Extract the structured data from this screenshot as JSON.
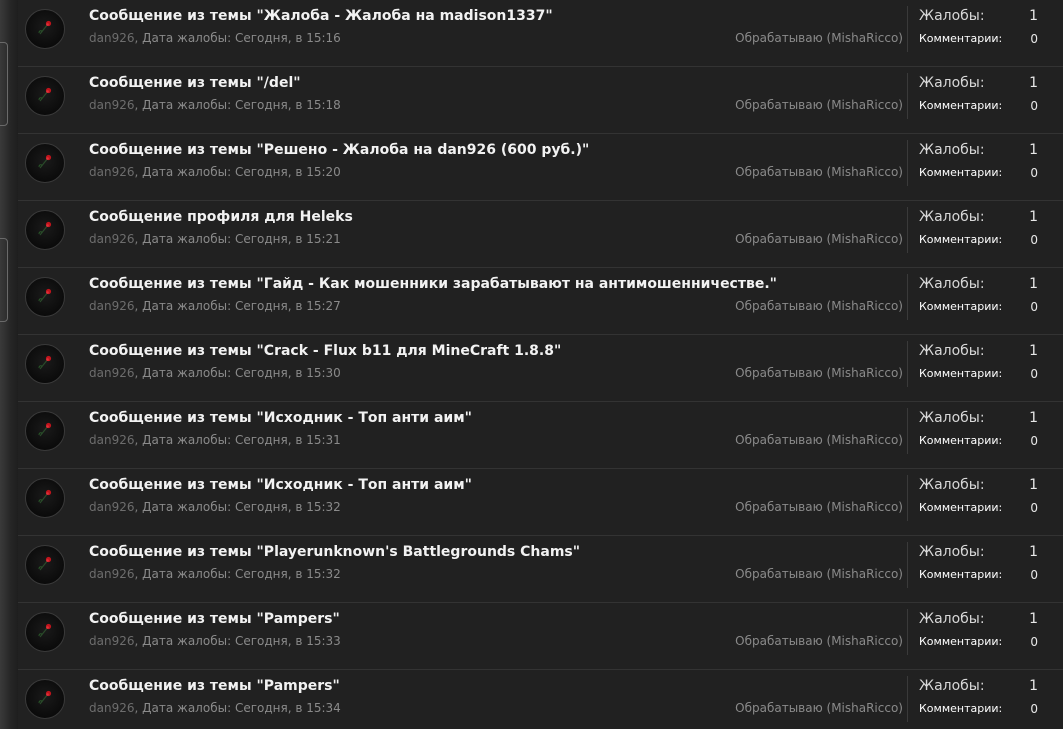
{
  "reports": [
    {
      "title": "Сообщение из темы \"Жалоба - Жалоба на madison1337\"",
      "user": "dan926",
      "date_label": "Дата жалобы:",
      "date": "Сегодня, в 15:16",
      "status": "Обрабатываю (MishaRicco)",
      "complaints_label": "Жалобы:",
      "complaints": "1",
      "comments_label": "Комментарии:",
      "comments": "0"
    },
    {
      "title": "Сообщение из темы \"/del\"",
      "user": "dan926",
      "date_label": "Дата жалобы:",
      "date": "Сегодня, в 15:18",
      "status": "Обрабатываю (MishaRicco)",
      "complaints_label": "Жалобы:",
      "complaints": "1",
      "comments_label": "Комментарии:",
      "comments": "0"
    },
    {
      "title": "Сообщение из темы \"Решено - Жалоба на dan926 (600 руб.)\"",
      "user": "dan926",
      "date_label": "Дата жалобы:",
      "date": "Сегодня, в 15:20",
      "status": "Обрабатываю (MishaRicco)",
      "complaints_label": "Жалобы:",
      "complaints": "1",
      "comments_label": "Комментарии:",
      "comments": "0"
    },
    {
      "title": "Сообщение профиля для Heleks",
      "user": "dan926",
      "date_label": "Дата жалобы:",
      "date": "Сегодня, в 15:21",
      "status": "Обрабатываю (MishaRicco)",
      "complaints_label": "Жалобы:",
      "complaints": "1",
      "comments_label": "Комментарии:",
      "comments": "0"
    },
    {
      "title": "Сообщение из темы \"Гайд - Как мошенники зарабатывают на антимошенничестве.\"",
      "user": "dan926",
      "date_label": "Дата жалобы:",
      "date": "Сегодня, в 15:27",
      "status": "Обрабатываю (MishaRicco)",
      "complaints_label": "Жалобы:",
      "complaints": "1",
      "comments_label": "Комментарии:",
      "comments": "0"
    },
    {
      "title": "Сообщение из темы \"Crack - Flux b11 для MineCraft 1.8.8\"",
      "user": "dan926",
      "date_label": "Дата жалобы:",
      "date": "Сегодня, в 15:30",
      "status": "Обрабатываю (MishaRicco)",
      "complaints_label": "Жалобы:",
      "complaints": "1",
      "comments_label": "Комментарии:",
      "comments": "0"
    },
    {
      "title": "Сообщение из темы \"Исходник - Топ анти аим\"",
      "user": "dan926",
      "date_label": "Дата жалобы:",
      "date": "Сегодня, в 15:31",
      "status": "Обрабатываю (MishaRicco)",
      "complaints_label": "Жалобы:",
      "complaints": "1",
      "comments_label": "Комментарии:",
      "comments": "0"
    },
    {
      "title": "Сообщение из темы \"Исходник - Топ анти аим\"",
      "user": "dan926",
      "date_label": "Дата жалобы:",
      "date": "Сегодня, в 15:32",
      "status": "Обрабатываю (MishaRicco)",
      "complaints_label": "Жалобы:",
      "complaints": "1",
      "comments_label": "Комментарии:",
      "comments": "0"
    },
    {
      "title": "Сообщение из темы \"Playerunknown's Battlegrounds Chams\"",
      "user": "dan926",
      "date_label": "Дата жалобы:",
      "date": "Сегодня, в 15:32",
      "status": "Обрабатываю (MishaRicco)",
      "complaints_label": "Жалобы:",
      "complaints": "1",
      "comments_label": "Комментарии:",
      "comments": "0"
    },
    {
      "title": "Сообщение из темы \"Pampers\"",
      "user": "dan926",
      "date_label": "Дата жалобы:",
      "date": "Сегодня, в 15:33",
      "status": "Обрабатываю (MishaRicco)",
      "complaints_label": "Жалобы:",
      "complaints": "1",
      "comments_label": "Комментарии:",
      "comments": "0"
    },
    {
      "title": "Сообщение из темы \"Pampers\"",
      "user": "dan926",
      "date_label": "Дата жалобы:",
      "date": "Сегодня, в 15:34",
      "status": "Обрабатываю (MishaRicco)",
      "complaints_label": "Жалобы:",
      "complaints": "1",
      "comments_label": "Комментарии:",
      "comments": "0"
    }
  ],
  "colors": {
    "background": "#212121",
    "title": "#f2f2f2",
    "meta": "#8a8a8a",
    "avatar_accent": "#c0141c"
  },
  "icons": {
    "avatar": "rose-avatar-icon"
  }
}
